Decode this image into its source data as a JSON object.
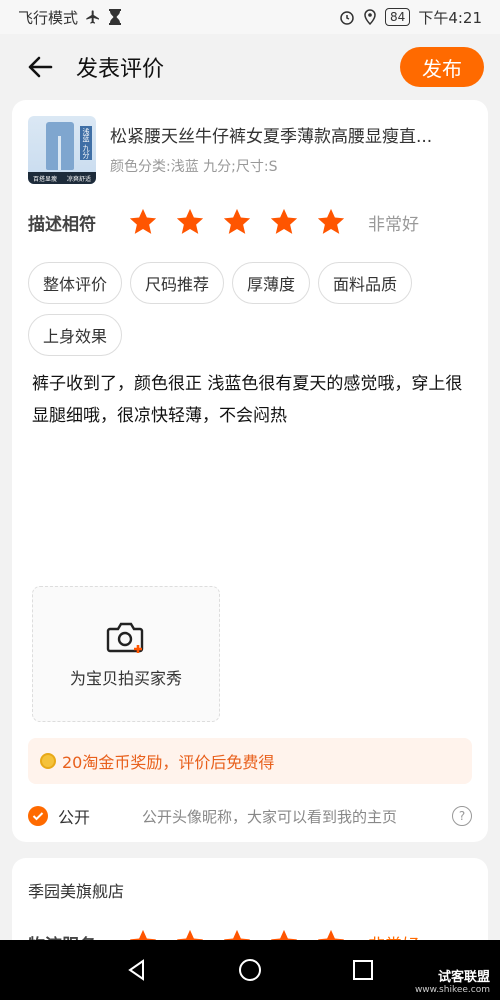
{
  "status": {
    "mode": "飞行模式",
    "battery": "84",
    "time": "下午4:21"
  },
  "header": {
    "title": "发表评价",
    "publish_label": "发布"
  },
  "product": {
    "name": "松紧腰天丝牛仔裤女夏季薄款高腰显瘦直...",
    "spec": "颜色分类:浅蓝 九分;尺寸:S",
    "thumb_tag": "浅蓝 九分",
    "thumb_band": [
      "百搭显瘦",
      "凉爽舒适"
    ]
  },
  "rating": {
    "label": "描述相符",
    "stars": 5,
    "verdict": "非常好"
  },
  "tags": [
    "整体评价",
    "尺码推荐",
    "厚薄度",
    "面料品质",
    "上身效果"
  ],
  "review": {
    "text": "裤子收到了，颜色很正 浅蓝色很有夏天的感觉哦，穿上很显腿细哦，很凉快轻薄，不会闷热"
  },
  "photo": {
    "label": "为宝贝拍买家秀"
  },
  "reward": {
    "text": "20淘金币奖励，评价后免费得"
  },
  "public": {
    "label": "公开",
    "hint": "公开头像昵称，大家可以看到我的主页"
  },
  "shop": {
    "name": "季园美旗舰店",
    "rating_label": "物流服务",
    "stars": 5,
    "verdict": "非常好"
  },
  "watermark": {
    "line1": "试客联盟",
    "line2": "www.shikee.com"
  },
  "colors": {
    "accent": "#ff6a00",
    "star": "#ff5500"
  }
}
